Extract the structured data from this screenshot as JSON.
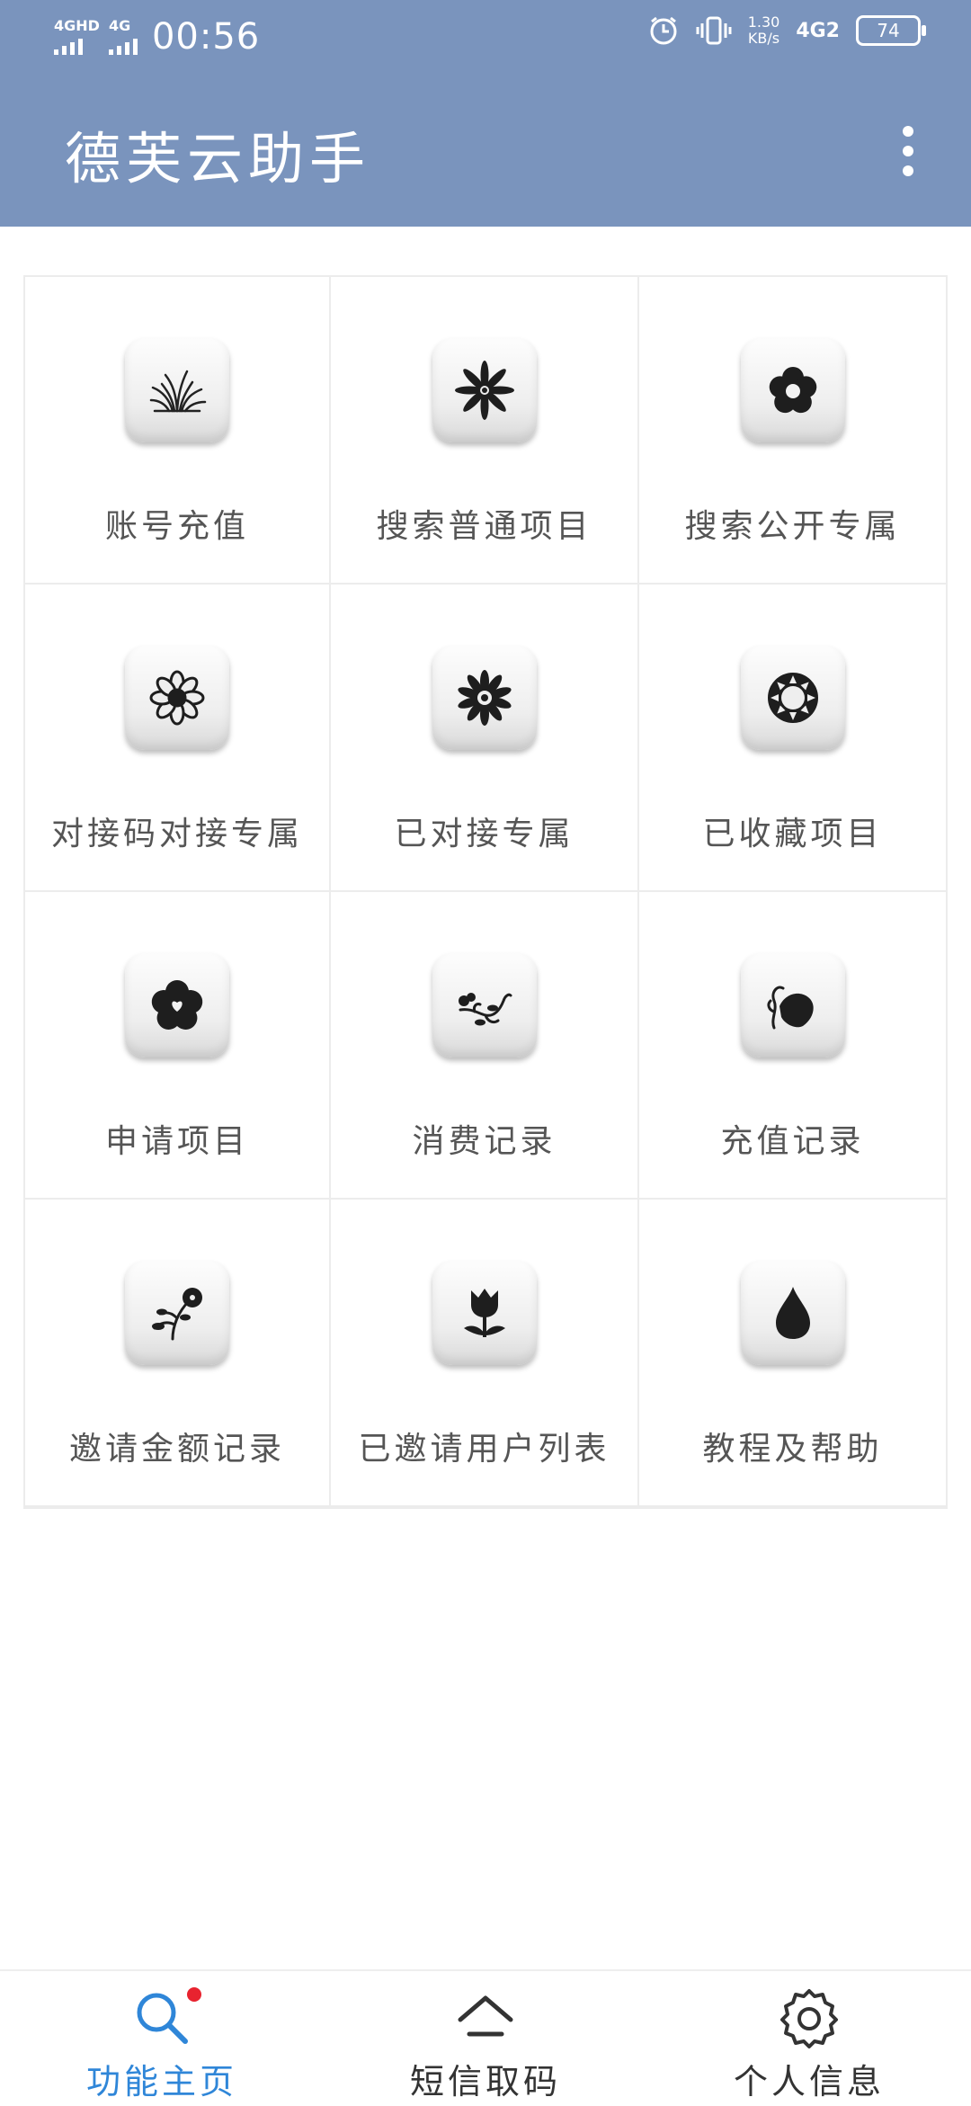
{
  "status_bar": {
    "sim1_label": "4GHD",
    "sim2_label": "4G",
    "time": "00:56",
    "net_speed_value": "1.30",
    "net_speed_unit": "KB/s",
    "network": "4G2",
    "battery": "74"
  },
  "app_bar": {
    "title": "德芙云助手"
  },
  "grid": {
    "items": [
      {
        "label": "账号充值",
        "icon": "grass-icon"
      },
      {
        "label": "搜索普通项目",
        "icon": "flower-star-icon"
      },
      {
        "label": "搜索公开专属",
        "icon": "flower-five-petal-icon"
      },
      {
        "label": "对接码对接专属",
        "icon": "daisy-icon"
      },
      {
        "label": "已对接专属",
        "icon": "chrysanthemum-icon"
      },
      {
        "label": "已收藏项目",
        "icon": "sun-icon"
      },
      {
        "label": "申请项目",
        "icon": "flower-heart-icon"
      },
      {
        "label": "消费记录",
        "icon": "vine-icon"
      },
      {
        "label": "充值记录",
        "icon": "leaf-heart-icon"
      },
      {
        "label": "邀请金额记录",
        "icon": "flower-stem-icon"
      },
      {
        "label": "已邀请用户列表",
        "icon": "tulip-icon"
      },
      {
        "label": "教程及帮助",
        "icon": "droplet-icon"
      }
    ]
  },
  "bottom_nav": {
    "items": [
      {
        "label": "功能主页",
        "icon": "search-icon"
      },
      {
        "label": "短信取码",
        "icon": "home-icon"
      },
      {
        "label": "个人信息",
        "icon": "gear-icon"
      }
    ],
    "active_color": "#2f86d8"
  },
  "colors": {
    "app_bar": "#7a94bd",
    "badge_dot": "#e8232f"
  }
}
